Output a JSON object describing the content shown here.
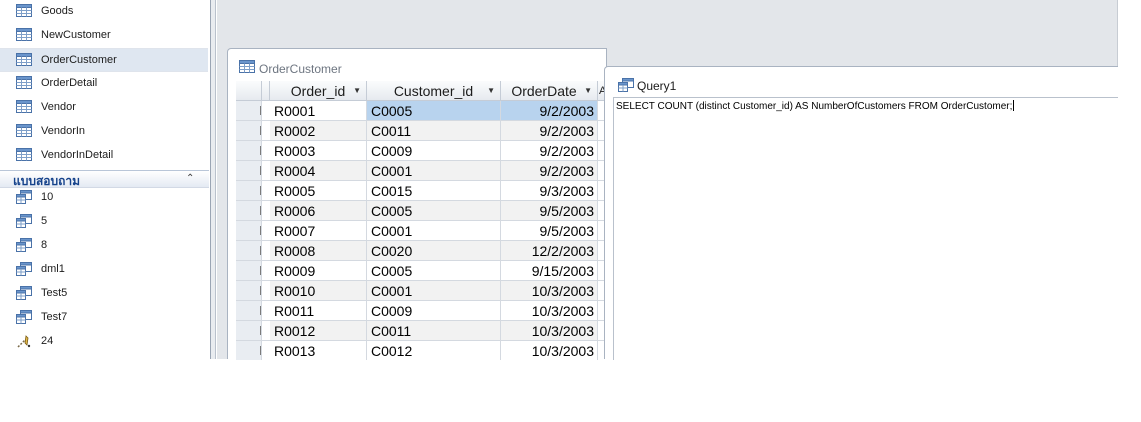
{
  "nav": {
    "tables": [
      "Goods",
      "NewCustomer",
      "OrderCustomer",
      "OrderDetail",
      "Vendor",
      "VendorIn",
      "VendorInDetail"
    ],
    "selected_table": "OrderCustomer",
    "queries_header": "แบบสอบถาม",
    "queries": [
      "10",
      "5",
      "8",
      "dml1",
      "Test5",
      "Test7"
    ],
    "macro_item": "24"
  },
  "table_window": {
    "title": "OrderCustomer",
    "columns": [
      "Order_id",
      "Customer_id",
      "OrderDate"
    ],
    "rows": [
      [
        "R0001",
        "C0005",
        "9/2/2003"
      ],
      [
        "R0002",
        "C0011",
        "9/2/2003"
      ],
      [
        "R0003",
        "C0009",
        "9/2/2003"
      ],
      [
        "R0004",
        "C0001",
        "9/2/2003"
      ],
      [
        "R0005",
        "C0015",
        "9/3/2003"
      ],
      [
        "R0006",
        "C0005",
        "9/5/2003"
      ],
      [
        "R0007",
        "C0001",
        "9/5/2003"
      ],
      [
        "R0008",
        "C0020",
        "12/2/2003"
      ],
      [
        "R0009",
        "C0005",
        "9/15/2003"
      ],
      [
        "R0010",
        "C0001",
        "10/3/2003"
      ],
      [
        "R0011",
        "C0009",
        "10/3/2003"
      ],
      [
        "R0012",
        "C0011",
        "10/3/2003"
      ],
      [
        "R0013",
        "C0012",
        "10/3/2003"
      ]
    ],
    "partial_column": "A"
  },
  "query_window": {
    "title": "Query1",
    "sql": "SELECT COUNT (distinct Customer_id) AS NumberOfCustomers FROM  OrderCustomer;"
  },
  "colors": {
    "selection": "#b8d3ee",
    "nav_header_text": "#15428b",
    "workspace": "#e3e6ea"
  }
}
